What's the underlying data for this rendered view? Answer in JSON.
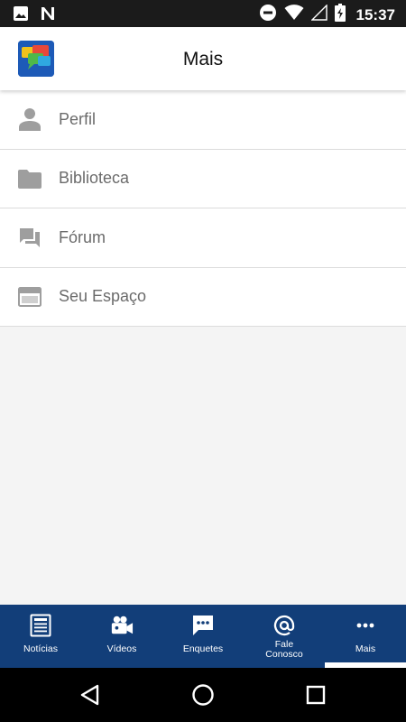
{
  "status_bar": {
    "time": "15:37",
    "icons": [
      "image-icon",
      "n-notification-icon",
      "do-not-disturb-icon",
      "wifi-icon",
      "signal-empty-icon",
      "battery-charging-icon"
    ]
  },
  "header": {
    "title": "Mais",
    "logo_icon": "app-logo-speech-bubbles"
  },
  "menu": {
    "items": [
      {
        "label": "Perfil",
        "icon": "person-icon"
      },
      {
        "label": "Biblioteca",
        "icon": "folder-icon"
      },
      {
        "label": "Fórum",
        "icon": "forum-icon"
      },
      {
        "label": "Seu Espaço",
        "icon": "browser-window-icon"
      }
    ]
  },
  "bottom_nav": {
    "tabs": [
      {
        "label": "Notícias",
        "icon": "newspaper-icon"
      },
      {
        "label": "Vídeos",
        "icon": "video-camera-icon"
      },
      {
        "label": "Enquetes",
        "icon": "chat-dots-icon"
      },
      {
        "label_line1": "Fale",
        "label_line2": "Conosco",
        "icon": "at-sign-icon"
      },
      {
        "label": "Mais",
        "icon": "more-dots-icon",
        "active": true
      }
    ]
  },
  "system_nav": [
    "back-icon",
    "home-icon",
    "recents-icon"
  ],
  "colors": {
    "nav_background": "#123e79",
    "status_bar": "#1b1b1b",
    "content_background": "#f4f4f4",
    "menu_icon_gray": "#9e9e9e"
  }
}
